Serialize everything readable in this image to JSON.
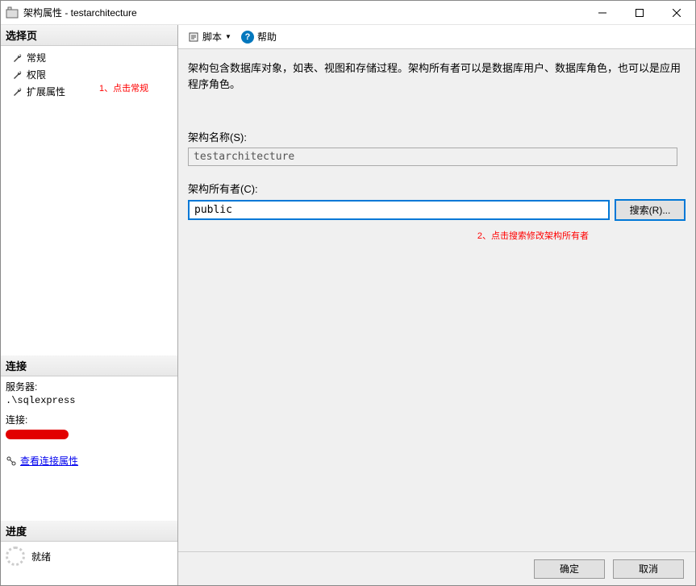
{
  "window": {
    "title": "架构属性 - testarchitecture"
  },
  "left": {
    "select_page_header": "选择页",
    "pages": [
      "常规",
      "权限",
      "扩展属性"
    ],
    "annotation1": "1、点击常规",
    "connection_header": "连接",
    "server_label": "服务器:",
    "server_value": ".\\sqlexpress",
    "conn_label": "连接:",
    "view_conn_props": "查看连接属性",
    "progress_header": "进度",
    "progress_status": "就绪"
  },
  "toolbar": {
    "script": "脚本",
    "help": "帮助"
  },
  "content": {
    "description": "架构包含数据库对象，如表、视图和存储过程。架构所有者可以是数据库用户、数据库角色，也可以是应用程序角色。",
    "schema_name_label": "架构名称(S):",
    "schema_name_value": "testarchitecture",
    "schema_owner_label": "架构所有者(C):",
    "schema_owner_value": "public",
    "search_button": "搜索(R)...",
    "annotation2": "2、点击搜索修改架构所有者"
  },
  "footer": {
    "ok": "确定",
    "cancel": "取消"
  }
}
